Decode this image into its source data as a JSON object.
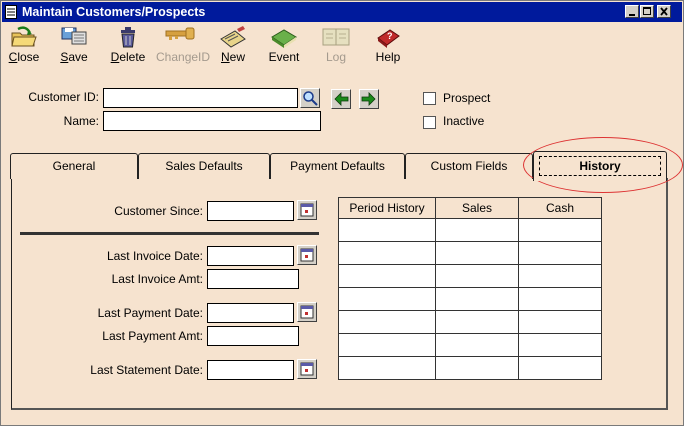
{
  "window": {
    "title": "Maintain Customers/Prospects",
    "controls": [
      "minimize",
      "maximize",
      "close"
    ]
  },
  "toolbar": {
    "items": [
      {
        "label": "Close",
        "underline": "C",
        "rest": "lose",
        "icon": "close-folder-icon",
        "enabled": true
      },
      {
        "label": "Save",
        "underline": "S",
        "rest": "ave",
        "icon": "save-disk-icon",
        "enabled": true
      },
      {
        "label": "Delete",
        "underline": "D",
        "rest": "elete",
        "icon": "trash-can-icon",
        "enabled": true
      },
      {
        "label": "ChangeID",
        "underline": "",
        "rest": "ChangeID",
        "icon": "key-icon",
        "enabled": false
      },
      {
        "label": "New",
        "underline": "N",
        "rest": "ew",
        "icon": "new-document-icon",
        "enabled": true
      },
      {
        "label": "Event",
        "underline": "",
        "rest": "Event",
        "icon": "event-book-icon",
        "enabled": true
      },
      {
        "label": "Log",
        "underline": "",
        "rest": "Log",
        "icon": "log-book-icon",
        "enabled": false
      },
      {
        "label": "Help",
        "underline": "",
        "rest": "Help",
        "icon": "help-book-icon",
        "enabled": true
      }
    ]
  },
  "header": {
    "customer_id_label": "Customer ID:",
    "customer_id_value": "",
    "name_label": "Name:",
    "name_value": "",
    "prospect_label": "Prospect",
    "prospect_checked": false,
    "inactive_label": "Inactive",
    "inactive_checked": false
  },
  "tabs": [
    {
      "label": "General",
      "active": false
    },
    {
      "label": "Sales Defaults",
      "active": false
    },
    {
      "label": "Payment Defaults",
      "active": false
    },
    {
      "label": "Custom Fields",
      "active": false
    },
    {
      "label": "History",
      "active": true
    }
  ],
  "history": {
    "customer_since_label": "Customer Since:",
    "customer_since_value": "",
    "last_invoice_date_label": "Last Invoice Date:",
    "last_invoice_date_value": "",
    "last_invoice_amt_label": "Last Invoice Amt:",
    "last_invoice_amt_value": "",
    "last_payment_date_label": "Last Payment Date:",
    "last_payment_date_value": "",
    "last_payment_amt_label": "Last Payment Amt:",
    "last_payment_amt_value": "",
    "last_statement_date_label": "Last Statement Date:",
    "last_statement_date_value": "",
    "table": {
      "columns": [
        "Period History",
        "Sales",
        "Cash"
      ],
      "rows": [
        [
          "",
          "",
          ""
        ],
        [
          "",
          "",
          ""
        ],
        [
          "",
          "",
          ""
        ],
        [
          "",
          "",
          ""
        ],
        [
          "",
          "",
          ""
        ],
        [
          "",
          "",
          ""
        ],
        [
          "",
          "",
          ""
        ]
      ]
    }
  },
  "annotation": {
    "color": "#d33333",
    "shape": "ellipse around History tab"
  }
}
